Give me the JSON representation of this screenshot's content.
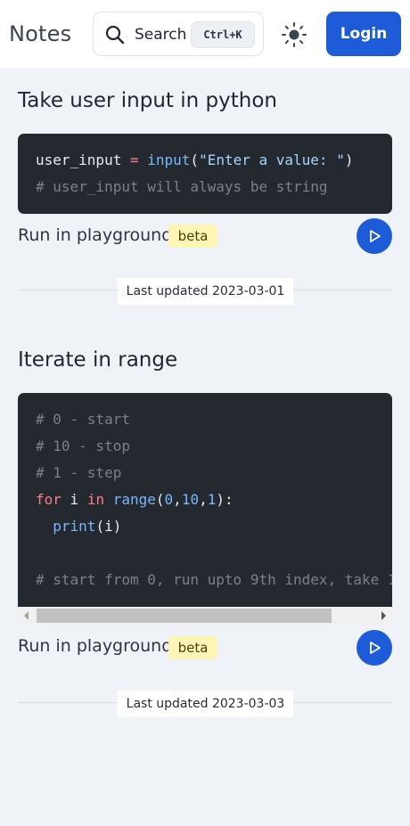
{
  "header": {
    "brand": "Notes",
    "search_label": "Search",
    "search_shortcut": "Ctrl+K",
    "login_label": "Login"
  },
  "notes": [
    {
      "title": "Take user input in python",
      "code_lines": [
        "user_input = input(\"Enter a value: \")",
        "# user_input will always be string"
      ],
      "run_label": "Run in playground",
      "badge": "beta",
      "updated": "Last updated 2023-03-01"
    },
    {
      "title": "Iterate in range",
      "code_lines": [
        "# 0 - start",
        "# 10 - stop",
        "# 1 - step",
        "for i in range(0,10,1):",
        "  print(i)",
        "",
        "# start from 0, run upto 9th index, take 1"
      ],
      "run_label": "Run in playground",
      "badge": "beta",
      "updated": "Last updated 2023-03-03"
    }
  ],
  "colors": {
    "accent": "#1d5bd8",
    "code_bg": "#24282f",
    "badge_bg": "#fdf5b5",
    "page_bg": "#eff2f7"
  },
  "icons": [
    "search-icon",
    "sun-icon",
    "play-icon",
    "scroll-left-arrow-icon",
    "scroll-right-arrow-icon"
  ]
}
